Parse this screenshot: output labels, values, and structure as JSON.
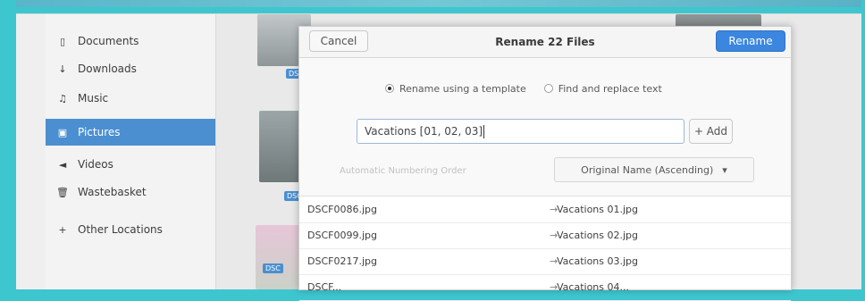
{
  "sidebar": {
    "items": [
      {
        "label": "Documents",
        "icon": "document-icon",
        "active": false
      },
      {
        "label": "Downloads",
        "icon": "download-icon",
        "active": false
      },
      {
        "label": "Music",
        "icon": "music-icon",
        "active": false
      },
      {
        "label": "Pictures",
        "icon": "image-icon",
        "active": true
      },
      {
        "label": "Videos",
        "icon": "video-icon",
        "active": false
      },
      {
        "label": "Wastebasket",
        "icon": "trash-icon",
        "active": false
      },
      {
        "label": "Other Locations",
        "icon": "plus-icon",
        "active": false
      }
    ]
  },
  "dialog": {
    "cancel_label": "Cancel",
    "title": "Rename 22 Files",
    "rename_label": "Rename",
    "mode_template_label": "Rename using a template",
    "mode_replace_label": "Find and replace text",
    "template_value": "Vacations [01, 02, 03]",
    "add_label": "+ Add",
    "numbering_label": "Automatic Numbering Order",
    "sort_label": "Original Name (Ascending)",
    "rows": [
      {
        "old": "DSCF0086.jpg",
        "new": "Vacations 01.jpg"
      },
      {
        "old": "DSCF0099.jpg",
        "new": "Vacations 02.jpg"
      },
      {
        "old": "DSCF0217.jpg",
        "new": "Vacations 03.jpg"
      },
      {
        "old": "DSCF...",
        "new": "Vacations 04..."
      }
    ]
  },
  "thumb_captions": [
    "DSC",
    "DSC",
    "DSC"
  ]
}
